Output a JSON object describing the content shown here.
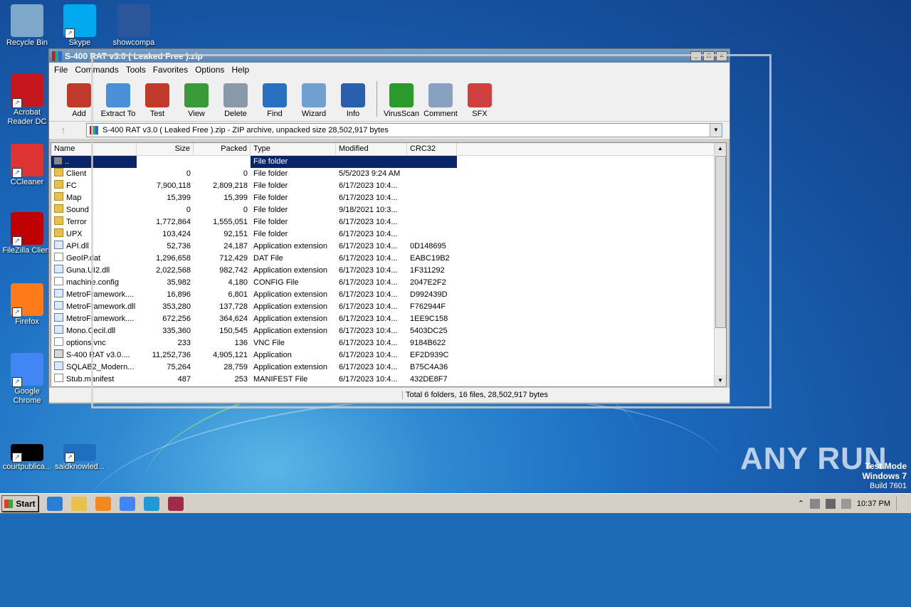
{
  "desktop": {
    "icons": [
      {
        "label": "Recycle Bin",
        "icon": "recycle-bin-icon",
        "color": "#7fa7c9"
      },
      {
        "label": "Skype",
        "icon": "skype-icon",
        "color": "#00a9f0"
      },
      {
        "label": "showcompa",
        "icon": "word-doc-icon",
        "color": "#2b579a"
      },
      {
        "label": "Acrobat Reader DC",
        "icon": "acrobat-icon",
        "color": "#c4161c"
      },
      {
        "label": "CCleaner",
        "icon": "ccleaner-icon",
        "color": "#d33"
      },
      {
        "label": "FileZilla Client",
        "icon": "filezilla-icon",
        "color": "#bf0000"
      },
      {
        "label": "Firefox",
        "icon": "firefox-icon",
        "color": "#ff7b1a"
      },
      {
        "label": "Google Chrome",
        "icon": "chrome-icon",
        "color": "#4285f4"
      },
      {
        "label": "courtpublica...",
        "icon": "black-file-icon",
        "color": "#000000"
      },
      {
        "label": "saidknowled...",
        "icon": "blank-file-icon",
        "color": "#1f6fc0"
      }
    ],
    "watermark": "ANY RUN",
    "testmode": {
      "line1": "Test Mode",
      "line2": "Windows 7",
      "line3": "Build 7601"
    }
  },
  "window": {
    "title": "S-400 RAT v3.0 ( Leaked Free ).zip",
    "menu": [
      "File",
      "Commands",
      "Tools",
      "Favorites",
      "Options",
      "Help"
    ],
    "toolbar": [
      {
        "label": "Add",
        "icon": "add-archive-icon",
        "color": "#c0392b"
      },
      {
        "label": "Extract To",
        "icon": "extract-folder-icon",
        "color": "#4a90d9"
      },
      {
        "label": "Test",
        "icon": "test-clipboard-icon",
        "color": "#c0392b"
      },
      {
        "label": "View",
        "icon": "view-book-icon",
        "color": "#3a9a3a"
      },
      {
        "label": "Delete",
        "icon": "trash-icon",
        "color": "#8899aa"
      },
      {
        "label": "Find",
        "icon": "magnifier-icon",
        "color": "#2a6fc0"
      },
      {
        "label": "Wizard",
        "icon": "wand-icon",
        "color": "#6fa0d0"
      },
      {
        "label": "Info",
        "icon": "info-icon",
        "color": "#2a5fb0"
      },
      {
        "label": "VirusScan",
        "icon": "virus-scan-icon",
        "color": "#2a9a2a"
      },
      {
        "label": "Comment",
        "icon": "comment-icon",
        "color": "#8aa0c0"
      },
      {
        "label": "SFX",
        "icon": "sfx-box-icon",
        "color": "#d04040"
      }
    ],
    "address": "S-400 RAT v3.0 ( Leaked Free ).zip - ZIP archive, unpacked size 28,502,917 bytes",
    "columns": [
      "Name",
      "Size",
      "Packed",
      "Type",
      "Modified",
      "CRC32"
    ],
    "rows": [
      {
        "name": "..",
        "size": "",
        "packed": "",
        "type": "File folder",
        "modified": "",
        "crc": "",
        "kind": "up",
        "selected": true
      },
      {
        "name": "Client",
        "size": "0",
        "packed": "0",
        "type": "File folder",
        "modified": "5/5/2023 9:24 AM",
        "crc": "",
        "kind": "folder"
      },
      {
        "name": "FC",
        "size": "7,900,118",
        "packed": "2,809,218",
        "type": "File folder",
        "modified": "6/17/2023 10:4...",
        "crc": "",
        "kind": "folder"
      },
      {
        "name": "Map",
        "size": "15,399",
        "packed": "15,399",
        "type": "File folder",
        "modified": "6/17/2023 10:4...",
        "crc": "",
        "kind": "folder"
      },
      {
        "name": "Sound",
        "size": "0",
        "packed": "0",
        "type": "File folder",
        "modified": "9/18/2021 10:3...",
        "crc": "",
        "kind": "folder"
      },
      {
        "name": "Terror",
        "size": "1,772,864",
        "packed": "1,555,051",
        "type": "File folder",
        "modified": "6/17/2023 10:4...",
        "crc": "",
        "kind": "folder"
      },
      {
        "name": "UPX",
        "size": "103,424",
        "packed": "92,151",
        "type": "File folder",
        "modified": "6/17/2023 10:4...",
        "crc": "",
        "kind": "folder"
      },
      {
        "name": "API.dll",
        "size": "52,736",
        "packed": "24,187",
        "type": "Application extension",
        "modified": "6/17/2023 10:4...",
        "crc": "0D148695",
        "kind": "dll"
      },
      {
        "name": "GeoIP.dat",
        "size": "1,296,658",
        "packed": "712,429",
        "type": "DAT File",
        "modified": "6/17/2023 10:4...",
        "crc": "EABC19B2",
        "kind": "file"
      },
      {
        "name": "Guna.UI2.dll",
        "size": "2,022,568",
        "packed": "982,742",
        "type": "Application extension",
        "modified": "6/17/2023 10:4...",
        "crc": "1F311292",
        "kind": "dll"
      },
      {
        "name": "machine.config",
        "size": "35,982",
        "packed": "4,180",
        "type": "CONFIG File",
        "modified": "6/17/2023 10:4...",
        "crc": "2047E2F2",
        "kind": "file"
      },
      {
        "name": "MetroFramework....",
        "size": "16,896",
        "packed": "6,801",
        "type": "Application extension",
        "modified": "6/17/2023 10:4...",
        "crc": "D992439D",
        "kind": "dll"
      },
      {
        "name": "MetroFramework.dll",
        "size": "353,280",
        "packed": "137,728",
        "type": "Application extension",
        "modified": "6/17/2023 10:4...",
        "crc": "F762944F",
        "kind": "dll"
      },
      {
        "name": "MetroFramework....",
        "size": "672,256",
        "packed": "364,624",
        "type": "Application extension",
        "modified": "6/17/2023 10:4...",
        "crc": "1EE9C158",
        "kind": "dll"
      },
      {
        "name": "Mono.Cecil.dll",
        "size": "335,360",
        "packed": "150,545",
        "type": "Application extension",
        "modified": "6/17/2023 10:4...",
        "crc": "5403DC25",
        "kind": "dll"
      },
      {
        "name": "options.vnc",
        "size": "233",
        "packed": "136",
        "type": "VNC File",
        "modified": "6/17/2023 10:4...",
        "crc": "9184B622",
        "kind": "file"
      },
      {
        "name": "S-400 RAT v3.0....",
        "size": "11,252,736",
        "packed": "4,905,121",
        "type": "Application",
        "modified": "6/17/2023 10:4...",
        "crc": "EF2D939C",
        "kind": "app"
      },
      {
        "name": "SQLAB2_Modern...",
        "size": "75,264",
        "packed": "28,759",
        "type": "Application extension",
        "modified": "6/17/2023 10:4...",
        "crc": "B75C4A36",
        "kind": "dll"
      },
      {
        "name": "Stub.manifest",
        "size": "487",
        "packed": "253",
        "type": "MANIFEST File",
        "modified": "6/17/2023 10:4...",
        "crc": "432DE8F7",
        "kind": "file"
      }
    ],
    "status": "Total 6 folders, 16 files, 28,502,917 bytes"
  },
  "taskbar": {
    "start": "Start",
    "apps": [
      {
        "icon": "ie-icon",
        "color": "#2a7fd4"
      },
      {
        "icon": "explorer-icon",
        "color": "#e8c14a"
      },
      {
        "icon": "media-player-icon",
        "color": "#f08a20"
      },
      {
        "icon": "chrome-icon",
        "color": "#4285f4"
      },
      {
        "icon": "edge-icon",
        "color": "#1f9ad6"
      },
      {
        "icon": "winrar-icon",
        "color": "#a02a4a"
      }
    ],
    "clock": "10:37 PM"
  }
}
